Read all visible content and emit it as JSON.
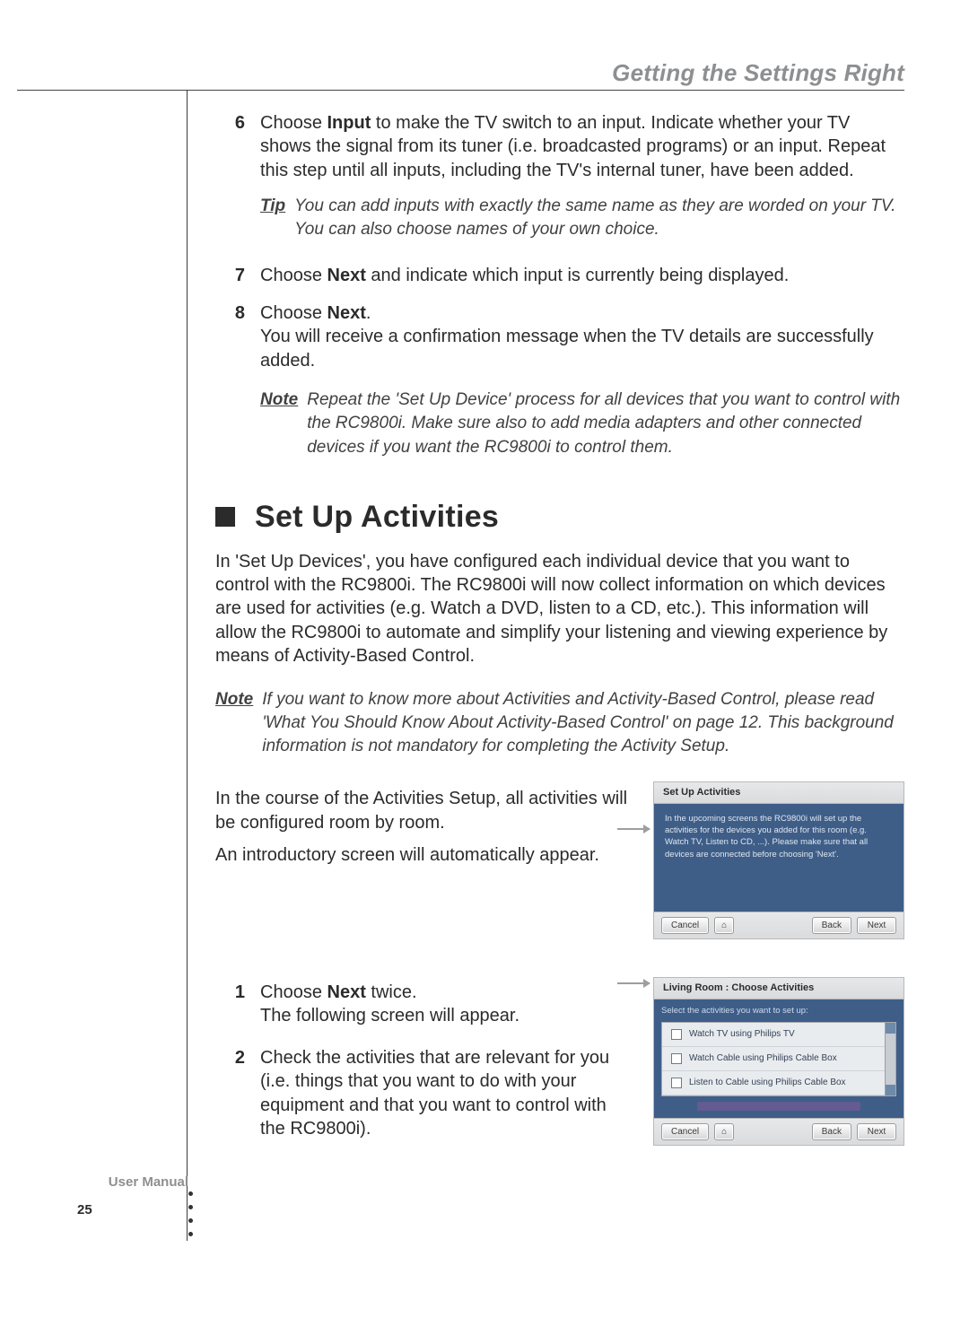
{
  "header": {
    "section": "Getting the Settings Right"
  },
  "steps_a": [
    {
      "n": "6",
      "pre": "Choose ",
      "bold": "Input",
      "post": " to make the TV switch to an input. Indicate whether your TV shows the signal from its tuner (i.e. broadcasted programs) or an input. Repeat this step until all inputs, including the TV's internal tuner, have been added."
    },
    {
      "n": "7",
      "pre": "Choose ",
      "bold": "Next",
      "post": " and indicate which input is currently being displayed."
    },
    {
      "n": "8",
      "pre": "Choose ",
      "bold": "Next",
      "post": ".",
      "extra": "You will receive a confirmation message when the TV details are successfully added."
    }
  ],
  "tip": {
    "label": "Tip",
    "text": "You can add inputs with exactly the same name as they are worded on your TV. You can also choose names of your own choice."
  },
  "note_a": {
    "label": "Note",
    "text": "Repeat the 'Set Up Device' process for all devices that you want to control with the RC9800i. Make sure also to add media adapters and other connected devices if you want the RC9800i to control them."
  },
  "h2": "Set Up Activities",
  "intro": "In 'Set Up Devices', you have configured each individual device that you want to control with the RC9800i. The RC9800i will now collect information on which devices are used for activities (e.g. Watch a DVD, listen to a CD, etc.). This information will allow the RC9800i to automate and simplify your listening and viewing experience by means of Activity-Based Control.",
  "note_b": {
    "label": "Note",
    "text": "If you want to know more about Activities and Activity-Based Control, please read 'What You Should Know About Activity-Based Control' on page 12. This background information is not mandatory for completing the Activity Setup."
  },
  "para1": "In the course of the Activities Setup, all activities will be configured room by room.",
  "para2": "An introductory screen will automatically appear.",
  "shot1": {
    "title": "Set Up Activities",
    "body": "In the upcoming screens the RC9800i will set up the activities for the devices you added for this room (e.g. Watch TV, Listen to CD, ...). Please make sure that all devices are connected before choosing 'Next'.",
    "cancel": "Cancel",
    "home": "⌂",
    "back": "Back",
    "next": "Next"
  },
  "steps_b": [
    {
      "n": "1",
      "pre": "Choose ",
      "bold": "Next",
      "post": " twice.",
      "extra": "The following screen will appear."
    },
    {
      "n": "2",
      "pre": "",
      "bold": "",
      "post": "Check the activities that are relevant for you (i.e. things that you want to do with your equipment and that you want to control with the RC9800i)."
    }
  ],
  "shot2": {
    "title": "Living Room : Choose Activities",
    "sub": "Select the activities you want to set up:",
    "items": [
      "Watch TV using Philips TV",
      "Watch Cable using Philips Cable Box",
      "Listen to Cable using Philips Cable Box"
    ],
    "cancel": "Cancel",
    "home": "⌂",
    "back": "Back",
    "next": "Next"
  },
  "footer": {
    "label": "User Manual",
    "page": "25"
  }
}
